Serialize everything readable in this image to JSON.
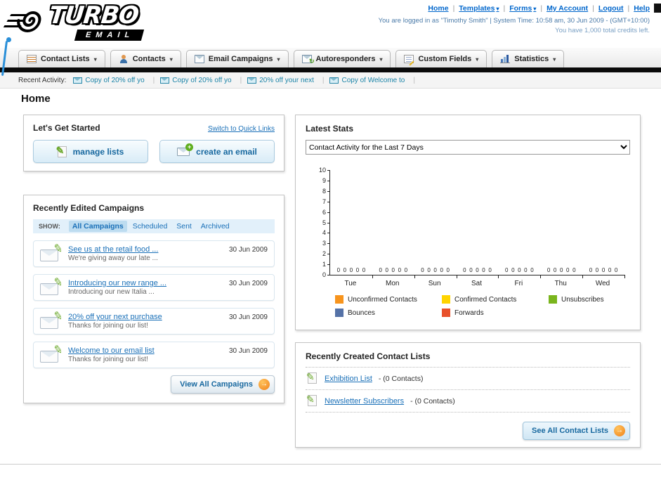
{
  "header": {
    "logo": {
      "title": "TURBO",
      "subtitle": "EMAIL"
    },
    "top_links": [
      {
        "label": "Home",
        "has_menu": false
      },
      {
        "label": "Templates",
        "has_menu": true
      },
      {
        "label": "Forms",
        "has_menu": true
      },
      {
        "label": "My Account",
        "has_menu": false
      },
      {
        "label": "Logout",
        "has_menu": false
      },
      {
        "label": "Help",
        "has_menu": false
      }
    ],
    "login_info": "You are logged in as \"Timothy Smith\" | System Time: 10:58 am, 30 Jun 2009 - (GMT+10:00)",
    "credits_info": "You have 1,000 total credits left."
  },
  "nav": {
    "tabs": [
      {
        "label": "Contact Lists",
        "icon": "contact-lists-icon"
      },
      {
        "label": "Contacts",
        "icon": "contacts-icon"
      },
      {
        "label": "Email Campaigns",
        "icon": "email-campaigns-icon"
      },
      {
        "label": "Autoresponders",
        "icon": "autoresponders-icon"
      },
      {
        "label": "Custom Fields",
        "icon": "custom-fields-icon"
      },
      {
        "label": "Statistics",
        "icon": "statistics-icon"
      }
    ]
  },
  "recent_activity": {
    "label": "Recent Activity:",
    "items": [
      "Copy of 20% off yo",
      "Copy of 20% off yo",
      "20% off your next",
      "Copy of Welcome to"
    ]
  },
  "page_title": "Home",
  "get_started": {
    "title": "Let's Get Started",
    "switch_link": "Switch to Quick Links",
    "buttons": {
      "manage": "manage lists",
      "create": "create an email"
    }
  },
  "campaigns": {
    "title": "Recently Edited Campaigns",
    "show_label": "SHOW:",
    "filters": [
      {
        "label": "All Campaigns",
        "active": true
      },
      {
        "label": "Scheduled",
        "active": false
      },
      {
        "label": "Sent",
        "active": false
      },
      {
        "label": "Archived",
        "active": false
      }
    ],
    "items": [
      {
        "title": "See us at the retail food ...",
        "subtitle": "We're giving away our late ...",
        "date": "30 Jun 2009"
      },
      {
        "title": "Introducing our new range ...",
        "subtitle": "Introducing our new Italia ...",
        "date": "30 Jun 2009"
      },
      {
        "title": "20% off your next purchase",
        "subtitle": "Thanks for joining our list!",
        "date": "30 Jun 2009"
      },
      {
        "title": "Welcome to our email list",
        "subtitle": "Thanks for joining our list!",
        "date": "30 Jun 2009"
      }
    ],
    "view_all_label": "View All Campaigns"
  },
  "latest_stats": {
    "title": "Latest Stats",
    "dropdown_value": "Contact Activity for the Last 7 Days"
  },
  "chart_data": {
    "type": "bar",
    "title": "Contact Activity for the Last 7 Days",
    "categories": [
      "Tue",
      "Mon",
      "Sun",
      "Sat",
      "Fri",
      "Thu",
      "Wed"
    ],
    "series": [
      {
        "name": "Unconfirmed Contacts",
        "color": "#f7941d",
        "values": [
          0,
          0,
          0,
          0,
          0,
          0,
          0
        ]
      },
      {
        "name": "Confirmed Contacts",
        "color": "#ffd400",
        "values": [
          0,
          0,
          0,
          0,
          0,
          0,
          0
        ]
      },
      {
        "name": "Unsubscribes",
        "color": "#7ab51d",
        "values": [
          0,
          0,
          0,
          0,
          0,
          0,
          0
        ]
      },
      {
        "name": "Bounces",
        "color": "#5572a7",
        "values": [
          0,
          0,
          0,
          0,
          0,
          0,
          0
        ]
      },
      {
        "name": "Forwards",
        "color": "#e8502a",
        "values": [
          0,
          0,
          0,
          0,
          0,
          0,
          0
        ]
      }
    ],
    "xlabel": "",
    "ylabel": "",
    "ylim": [
      0,
      10
    ],
    "yticks": [
      0,
      1,
      2,
      3,
      4,
      5,
      6,
      7,
      8,
      9,
      10
    ],
    "grid": false,
    "legend_position": "bottom"
  },
  "contact_lists": {
    "title": "Recently Created Contact Lists",
    "items": [
      {
        "name": "Exhibition List",
        "suffix": "- (0 Contacts)"
      },
      {
        "name": "Newsletter Subscribers",
        "suffix": "- (0 Contacts)"
      }
    ],
    "see_all_label": "See All Contact Lists"
  },
  "colors": {
    "link_blue": "#1a70b8",
    "button_text_blue": "#17689f",
    "arrow_orange": "#f08018",
    "nav_bar_black": "#0a0a0a"
  }
}
